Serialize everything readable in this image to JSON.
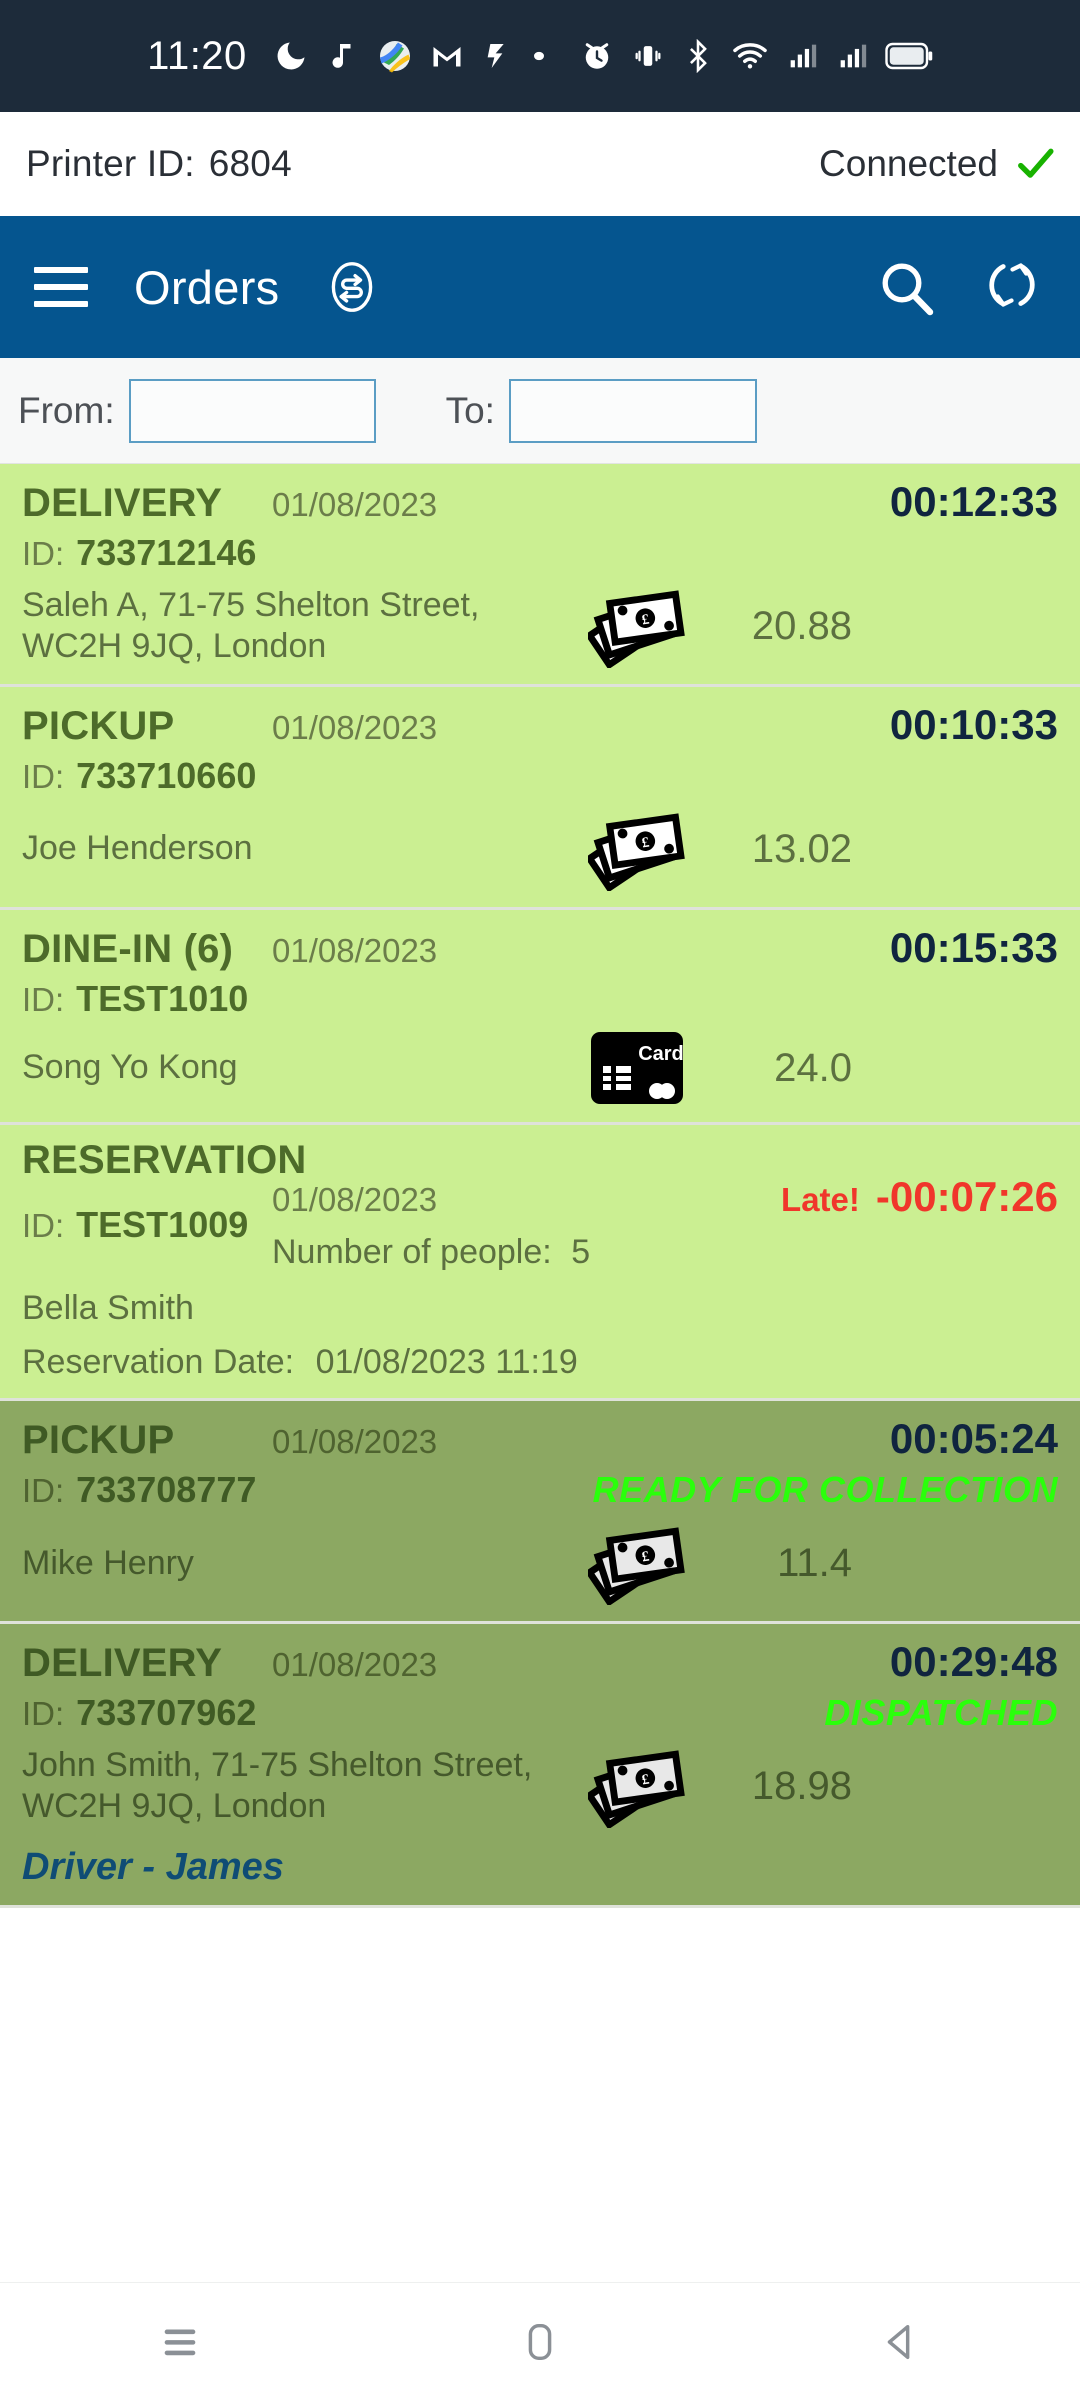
{
  "status_bar": {
    "time": "11:20",
    "icons": [
      "moon-dnd-icon",
      "music-note-icon",
      "maps-icon",
      "gmail-icon",
      "app-icon",
      "dot-icon",
      "alarm-icon",
      "vibrate-icon",
      "bluetooth-icon",
      "wifi-icon",
      "signal-sim1-icon",
      "signal-sim2-icon",
      "battery-icon"
    ]
  },
  "printer_bar": {
    "label": "Printer ID:",
    "printer_id": "6804",
    "connection_status": "Connected",
    "tick_icon": "check-icon",
    "tick_color": "#18b200"
  },
  "app_bar": {
    "menu_icon": "hamburger-menu-icon",
    "title": "Orders",
    "swap_icon": "swap-orders-icon",
    "search_icon": "search-icon",
    "refresh_icon": "refresh-icon",
    "background": "#05558f"
  },
  "filter": {
    "from_label": "From:",
    "from_value": "",
    "from_placeholder": "",
    "to_label": "To:",
    "to_value": "",
    "to_placeholder": ""
  },
  "colors": {
    "row_new": "#cbef92",
    "row_progress": "#8ca862",
    "status_tag": "#2aff0b",
    "late": "#f0362b",
    "driver": "#0f4c75"
  },
  "orders": [
    {
      "type": "DELIVERY",
      "date": "01/08/2023",
      "timer": "00:12:33",
      "late": false,
      "late_label": "",
      "id_label": "ID:",
      "id": "733712146",
      "customer": "Saleh A, 71-75 Shelton Street, WC2H 9JQ, London",
      "payment_icon": "cash-icon",
      "amount": "20.88",
      "status": "",
      "shade": "light"
    },
    {
      "type": "PICKUP",
      "date": "01/08/2023",
      "timer": "00:10:33",
      "late": false,
      "late_label": "",
      "id_label": "ID:",
      "id": "733710660",
      "customer": "Joe Henderson",
      "payment_icon": "cash-icon",
      "amount": "13.02",
      "status": "",
      "shade": "light"
    },
    {
      "type": "DINE-IN (6)",
      "date": "01/08/2023",
      "timer": "00:15:33",
      "late": false,
      "late_label": "",
      "id_label": "ID:",
      "id": "TEST1010",
      "customer": "Song Yo Kong",
      "payment_icon": "card-icon",
      "payment_icon_label": "Card",
      "amount": "24.0",
      "status": "",
      "shade": "light"
    },
    {
      "type": "RESERVATION",
      "date": "01/08/2023",
      "timer": "-00:07:26",
      "late": true,
      "late_label": "Late!",
      "id_label": "ID:",
      "id": "TEST1009",
      "customer": "Bella Smith",
      "people_label": "Number of people:",
      "people": "5",
      "reservation_date_label": "Reservation Date:",
      "reservation_date": "01/08/2023 11:19",
      "payment_icon": "",
      "amount": "",
      "status": "",
      "shade": "light"
    },
    {
      "type": "PICKUP",
      "date": "01/08/2023",
      "timer": "00:05:24",
      "late": false,
      "late_label": "",
      "id_label": "ID:",
      "id": "733708777",
      "customer": "Mike Henry",
      "payment_icon": "cash-icon",
      "amount": "11.4",
      "status": "READY FOR COLLECTION",
      "shade": "dark"
    },
    {
      "type": "DELIVERY",
      "date": "01/08/2023",
      "timer": "00:29:48",
      "late": false,
      "late_label": "",
      "id_label": "ID:",
      "id": "733707962",
      "customer": "John Smith, 71-75 Shelton Street, WC2H 9JQ, London",
      "payment_icon": "cash-icon",
      "amount": "18.98",
      "status": "DISPATCHED",
      "driver": "Driver - James",
      "shade": "dark"
    }
  ],
  "nav_bar": {
    "recents_icon": "recents-icon",
    "home_icon": "home-icon",
    "back_icon": "back-icon"
  }
}
